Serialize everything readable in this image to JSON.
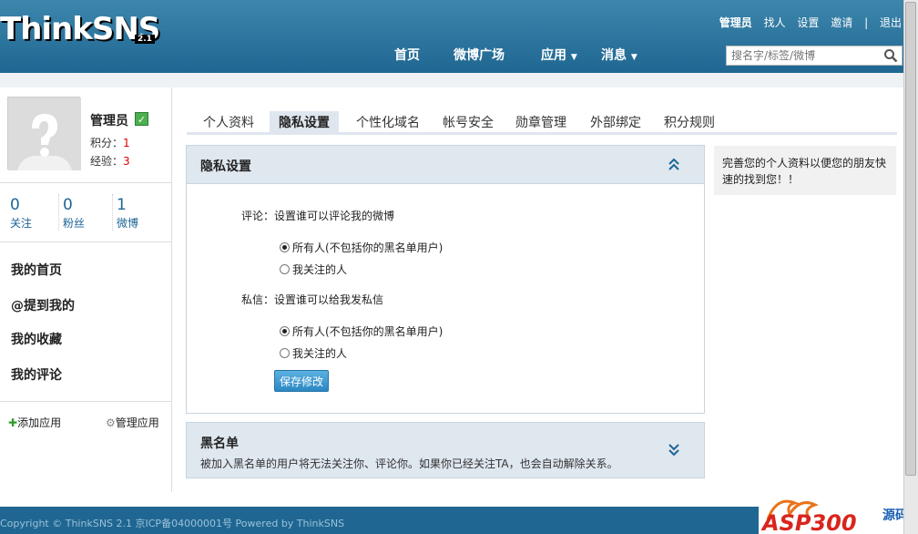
{
  "header": {
    "logo": "ThinkSNS",
    "logo_version": "2.1",
    "nav": [
      "首页",
      "微博广场",
      "应用",
      "消息"
    ],
    "user_links": [
      "管理员",
      "找人",
      "设置",
      "邀请",
      "|",
      "退出"
    ],
    "search_placeholder": "搜名字/标签/微博"
  },
  "profile": {
    "name": "管理员",
    "score_label": "积分：",
    "score_value": "1",
    "exp_label": "经验：",
    "exp_value": "3",
    "counts": [
      {
        "num": "0",
        "label": "关注"
      },
      {
        "num": "0",
        "label": "粉丝"
      },
      {
        "num": "1",
        "label": "微博"
      }
    ]
  },
  "sidebar_menu": [
    "我的首页",
    "@提到我的",
    "我的收藏",
    "我的评论"
  ],
  "apps": {
    "add": "添加应用",
    "manage": "管理应用"
  },
  "tabs": [
    "个人资料",
    "隐私设置",
    "个性化域名",
    "帐号安全",
    "勋章管理",
    "外部绑定",
    "积分规则"
  ],
  "active_tab": 1,
  "privacy": {
    "title": "隐私设置",
    "comment_q": "评论：设置谁可以评论我的微博",
    "message_q": "私信：设置谁可以给我发私信",
    "opt_all": "所有人(不包括你的黑名单用户)",
    "opt_follow": "我关注的人",
    "save": "保存修改"
  },
  "blacklist": {
    "title": "黑名单",
    "desc": "被加入黑名单的用户将无法关注你、评论你。如果你已经关注TA，也会自动解除关系。"
  },
  "side_note": "完善您的个人资料以便您的朋友快速的找到您！！",
  "footer": "Copyright © ThinkSNS 2.1 京ICP备04000001号 Powered by ThinkSNS",
  "brand": {
    "text1": "ASP300",
    "text2": "源码"
  },
  "colors": {
    "header": "#1f6792",
    "accent": "#2b88c4",
    "panel_head": "#dfe7ef"
  }
}
